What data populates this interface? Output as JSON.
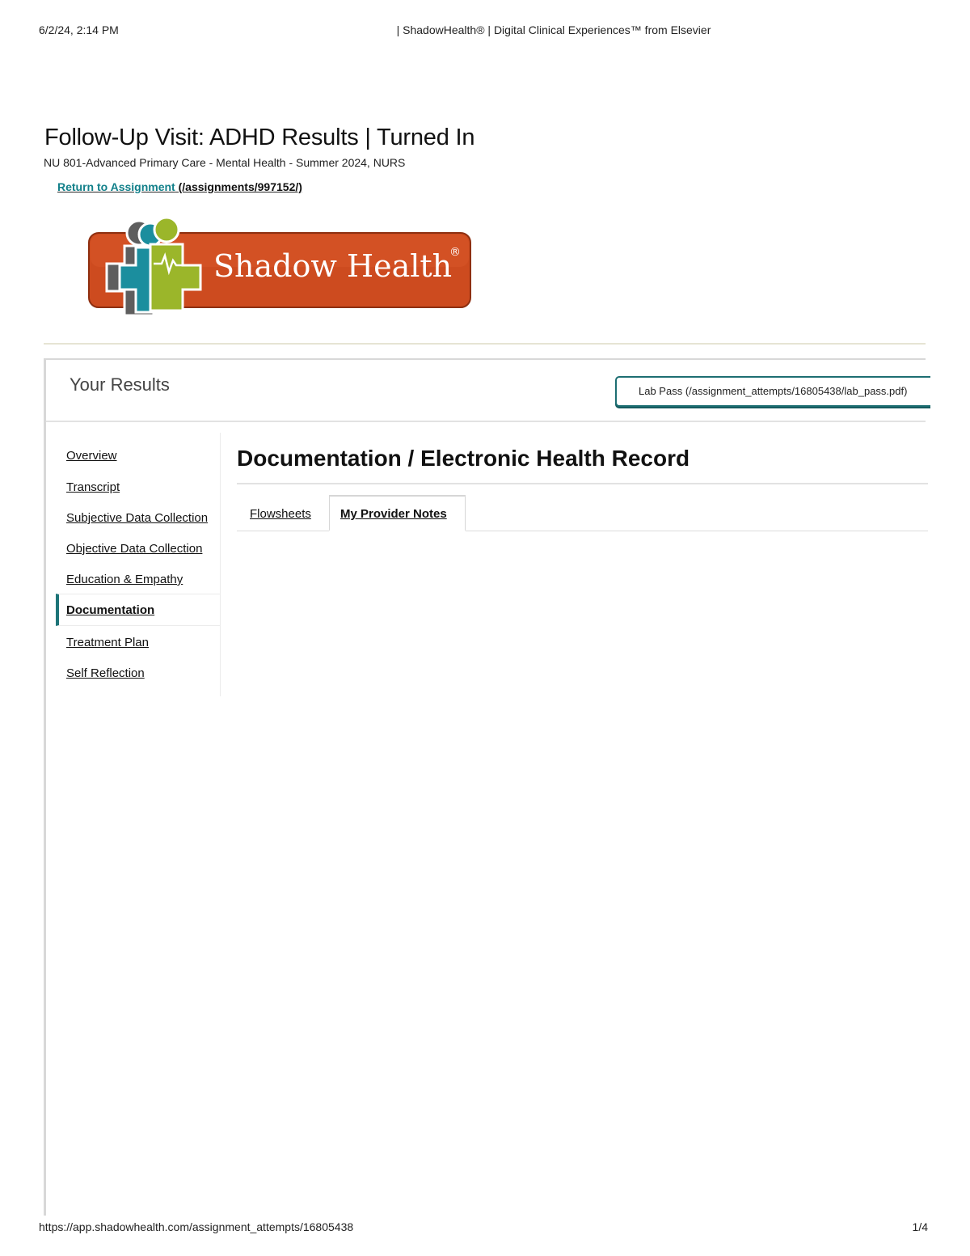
{
  "print_header": {
    "datetime": "6/2/24, 2:14 PM",
    "title": "| ShadowHealth® | Digital Clinical Experiences™ from Elsevier"
  },
  "print_footer": {
    "url": "https://app.shadowhealth.com/assignment_attempts/16805438",
    "page": "1/4"
  },
  "header": {
    "title": "Follow-Up Visit: ADHD Results | Turned In",
    "course": "NU 801-Advanced Primary Care - Mental Health - Summer 2024, NURS",
    "return_link_text": "Return to Assignment",
    "return_link_url": " (/assignments/997152/)"
  },
  "logo": {
    "text": "Shadow Health",
    "registered": "®",
    "colors": {
      "orange": "#cd4b1f",
      "gray": "#6a6a6a",
      "teal": "#1b8e9e",
      "green": "#9bb62a"
    }
  },
  "results": {
    "title": "Your Results",
    "lab_pass": "Lab Pass (/assignment_attempts/16805438/lab_pass.pdf)"
  },
  "nav": {
    "items": [
      {
        "label": "Overview",
        "active": false
      },
      {
        "label": "Transcript",
        "active": false
      },
      {
        "label": "Subjective Data Collection",
        "active": false
      },
      {
        "label": "Objective Data Collection",
        "active": false
      },
      {
        "label": "Education & Empathy",
        "active": false
      },
      {
        "label": "Documentation",
        "active": true
      },
      {
        "label": "Treatment Plan",
        "active": false
      },
      {
        "label": "Self Reflection",
        "active": false
      }
    ]
  },
  "section": {
    "title": "Documentation / Electronic Health Record",
    "tabs": [
      {
        "label": "Flowsheets",
        "active": false
      },
      {
        "label": "My Provider Notes",
        "active": true
      }
    ]
  },
  "colors": {
    "accent": "#1d7478",
    "link": "#12808a"
  }
}
